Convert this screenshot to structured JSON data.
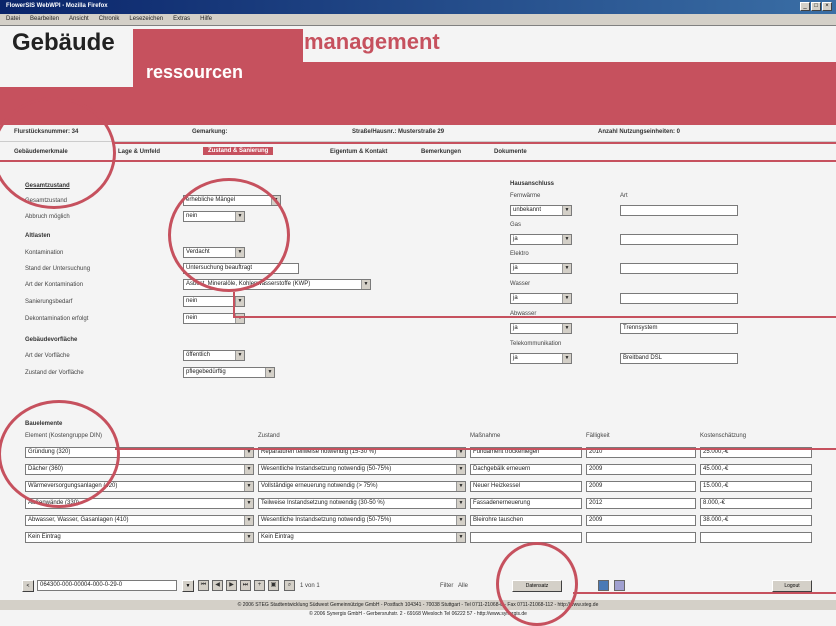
{
  "window": {
    "title": "FlowerSIS WebWPI - Mozilla Firefox",
    "controls": [
      "_",
      "□",
      "×"
    ]
  },
  "menu": [
    "Datei",
    "Bearbeiten",
    "Ansicht",
    "Chronik",
    "Lesezeichen",
    "Extras",
    "Hilfe"
  ],
  "header": {
    "title_left": "Gebäude",
    "title_right": "management",
    "subtitle": "ressourcen"
  },
  "info": {
    "flurstueck": "Flurstücksnummer: 34",
    "gemarkung": "Gemarkung:",
    "strasse": "Straße/Hausnr.: Musterstraße 29",
    "nutzungseinheiten": "Anzahl Nutzungseinheiten: 0"
  },
  "tabs": [
    "Gebäudemerkmale",
    "Lage & Umfeld",
    "Zustand & Sanierung",
    "Eigentum & Kontakt",
    "Bemerkungen",
    "Dokumente"
  ],
  "active_tab": "Zustand & Sanierung",
  "gesamtzustand": {
    "heading": "Gesamtzustand",
    "rows": [
      {
        "label": "Gesamtzustand",
        "value": "erhebliche Mängel"
      },
      {
        "label": "Abbruch möglich",
        "value": "nein"
      }
    ]
  },
  "altlasten": {
    "heading": "Altlasten",
    "rows": [
      {
        "label": "Kontamination",
        "value": "Verdacht"
      },
      {
        "label": "Stand der Untersuchung",
        "value": "Untersuchung beauftragt"
      },
      {
        "label": "Art der Kontamination",
        "value": "Asbest, Mineralöle, Kohlenwasserstoffe (KWP)"
      },
      {
        "label": "Sanierungsbedarf",
        "value": "nein"
      },
      {
        "label": "Dekontamination erfolgt",
        "value": "nein"
      }
    ]
  },
  "vorflaeche": {
    "heading": "Gebäudevorfläche",
    "rows": [
      {
        "label": "Art der Vorfläche",
        "value": "öffentlich"
      },
      {
        "label": "Zustand der Vorfläche",
        "value": "pflegebedürftig"
      }
    ]
  },
  "hausanschluss": {
    "heading": "Hausanschluss",
    "art_label": "Art",
    "rows": [
      {
        "label": "Fernwärme",
        "value": "unbekannt",
        "art": ""
      },
      {
        "label": "Gas",
        "value": "ja",
        "art": ""
      },
      {
        "label": "Elektro",
        "value": "ja",
        "art": ""
      },
      {
        "label": "Wasser",
        "value": "ja",
        "art": ""
      },
      {
        "label": "Abwasser",
        "value": "ja",
        "art": "Trennsystem"
      },
      {
        "label": "Telekommunikation",
        "value": "ja",
        "art": "Breitband DSL"
      }
    ]
  },
  "bauelemente": {
    "heading": "Bauelemente",
    "columns": [
      "Element (Kostengruppe DIN)",
      "Zustand",
      "Maßnahme",
      "Fälligkeit",
      "Kostenschätzung"
    ],
    "rows": [
      {
        "element": "Gründung (320)",
        "zustand": "Reparaturen teilweise notwendig (15-30 %)",
        "massnahme": "Fundament trockenlegen",
        "faellig": "2010",
        "kosten": "25.000,-€"
      },
      {
        "element": "Dächer (360)",
        "zustand": "Wesentliche Instandsetzung notwendig (50-75%)",
        "massnahme": "Dachgebälk erneuern",
        "faellig": "2009",
        "kosten": "45.000,-€"
      },
      {
        "element": "Wärmeversorgungsanlagen (420)",
        "zustand": "Vollständige erneuerung notwendig (> 75%)",
        "massnahme": "Neuer Heizkessel",
        "faellig": "2009",
        "kosten": "15.000,-€"
      },
      {
        "element": "Außenwände (330)",
        "zustand": "Teilweise Instandsetzung notwendig (30-50 %)",
        "massnahme": "Fassadenerneuerung",
        "faellig": "2012",
        "kosten": "8.000,-€"
      },
      {
        "element": "Abwasser, Wasser, Gasanlagen (410)",
        "zustand": "Wesentliche Instandsetzung notwendig (50-75%)",
        "massnahme": "Bleirohre tauschen",
        "faellig": "2009",
        "kosten": "38.000,-€"
      },
      {
        "element": "Kein Eintrag",
        "zustand": "Kein Eintrag",
        "massnahme": "",
        "faellig": "",
        "kosten": ""
      }
    ]
  },
  "pager": {
    "record_id": "064300-000-00004-000-0-29-0",
    "page_info": "1 von 1",
    "filter_label": "Filter",
    "filter_value": "Alle",
    "search_button": "Datensatz",
    "logout_button": "Logout"
  },
  "footer": {
    "line1": "© 2006 STEG Stadtentwicklung Südwest Gemeinnützige GmbH - Postfach 104341 - 70038 Stuttgart - Tel 0711-21068-0 - Fax 0711-21068-112 - http://www.steg.de",
    "line2": "© 2006 Synergis GmbH - Gerbersruhstr. 2 - 69168 Wiesloch Tel 06222 57 - http://www.synergis.de"
  },
  "colors": {
    "accent": "#c6515e"
  }
}
